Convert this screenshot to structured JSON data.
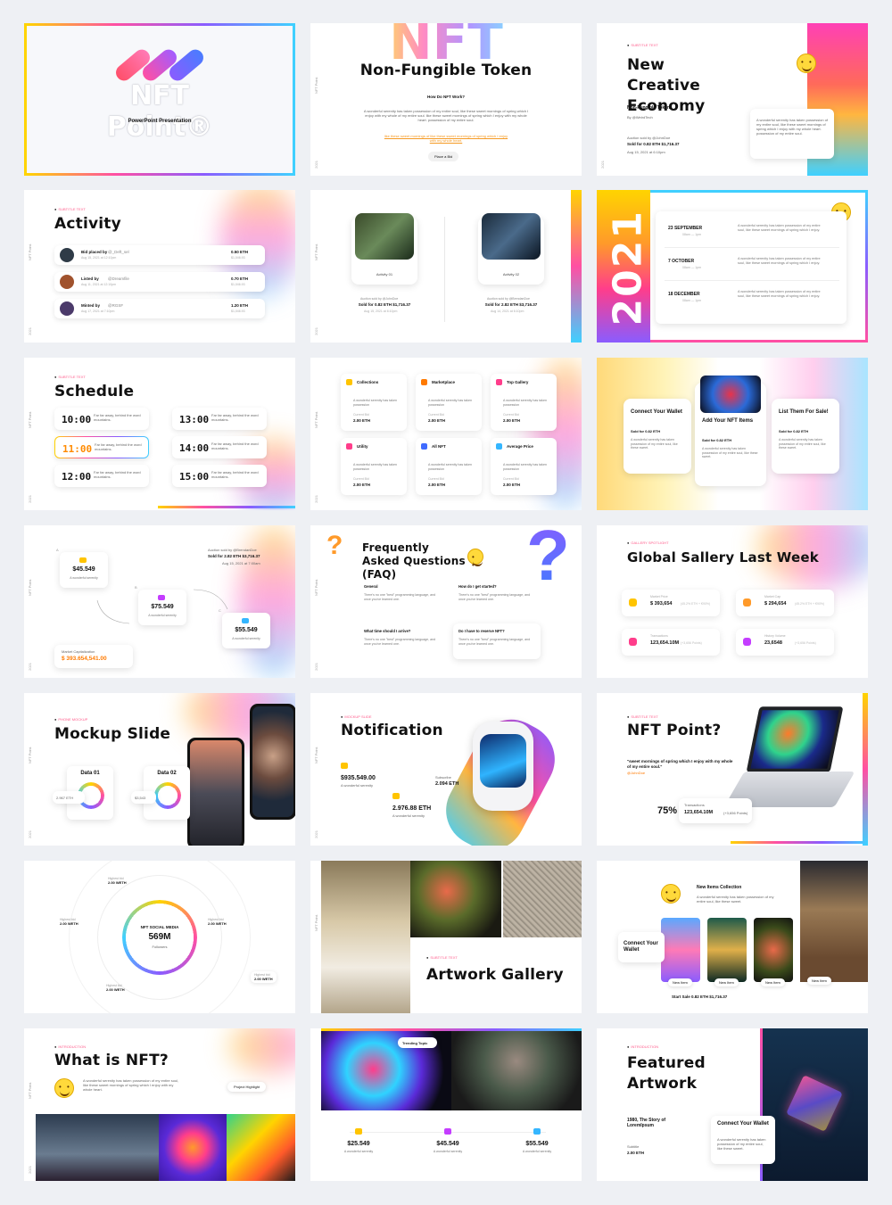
{
  "common": {
    "vertical_label": "NFT Point.",
    "year": "2021"
  },
  "s1": {
    "title": "NFT Point®",
    "subtitle": "PowerPoint Presentation"
  },
  "s2": {
    "bg_text": "NFT",
    "title": "Non-Fungible Token",
    "question": "How Do NFT Work?",
    "body": "A wonderful serenity has taken possession of my entire soul, like these sweet mornings of spring which I enjoy with my whole of my entire soul. like these sweet mornings of spring which I enjoy with my whole heart. possession of my entire soul.",
    "highlight": "like these sweet mornings of like these sweet mornings of spring which I enjoy with my whole heart.",
    "button": "Place a Bid"
  },
  "s3": {
    "tag": "SUBTITLE TEXT",
    "title": "New Creative Economy",
    "sub": "Non-Fungible Token",
    "by": "By @WeirdTech",
    "auction": "Auction sold by @JohnDoe",
    "sold": "Sold for 0.82 ETH $1,716.37",
    "date": "Aug 15, 2021 at 6:10pm",
    "card_text": "A wonderful serenity has taken possession of my entire soul, like these sweet mornings of spring which I enjoy with my whole heart. possession of my entire soul."
  },
  "s4": {
    "tag": "SUBTITLE TEXT",
    "title": "Activity",
    "rows": [
      {
        "label": "Bid placed by",
        "user": "@_Deft_sel",
        "date": "Aug 15, 2021 at 12:10pm",
        "eth": "0.50 ETH",
        "usd": "$1,046.93"
      },
      {
        "label": "Listed by",
        "user": "@Dreamfile",
        "date": "Aug 11, 2021 at 12:10pm",
        "eth": "0.70 ETH",
        "usd": "$1,046.93"
      },
      {
        "label": "Minted by",
        "user": "@RGSF",
        "date": "Aug 17, 2021 at 7:10pm",
        "eth": "1.20 ETH",
        "usd": "$1,046.93"
      }
    ]
  },
  "s5": {
    "cards": [
      {
        "label": "Activity 01",
        "auction": "Auction sold by @JohnDoe",
        "sold": "Sold for 0.82 ETH $1,716.37",
        "date": "Aug 15, 2021 at 6:10pm"
      },
      {
        "label": "Activity 02",
        "auction": "Auction sold by @BrendanDoe",
        "sold": "Sold for 2.82 ETH $3,716.37",
        "date": "Aug 14, 2021 at 6:10pm"
      }
    ]
  },
  "s6": {
    "year": "2021",
    "events": [
      {
        "date": "23 SEPTEMBER",
        "time": "08am — 1pm",
        "text": "A wonderful serenity has taken possession of my entire soul, like these sweet mornings of spring which I enjoy."
      },
      {
        "date": "7 OCTOBER",
        "time": "08am — 1pm",
        "text": "A wonderful serenity has taken possession of my entire soul, like these sweet mornings of spring which I enjoy."
      },
      {
        "date": "18 DECEMBER",
        "time": "08am — 1pm",
        "text": "A wonderful serenity has taken possession of my entire soul, like these sweet mornings of spring which I enjoy."
      }
    ]
  },
  "s7": {
    "tag": "SUBTITLE TEXT",
    "title": "Schedule",
    "desc": "Far far away, behind the word mountains.",
    "times": [
      "10:00",
      "11:00",
      "12:00",
      "13:00",
      "14:00",
      "15:00"
    ]
  },
  "s8": {
    "cards": [
      {
        "title": "Collections",
        "text": "A wonderful serenity has taken possession",
        "label": "Current Bid",
        "value": "2.00 ETH"
      },
      {
        "title": "Marketplace",
        "text": "A wonderful serenity has taken possession",
        "label": "Current Bid",
        "value": "2.00 ETH"
      },
      {
        "title": "Top Gallery",
        "text": "A wonderful serenity has taken possession",
        "label": "Current Bid",
        "value": "2.00 ETH"
      },
      {
        "title": "Utility",
        "text": "A wonderful serenity has taken possession",
        "label": "Current Bid",
        "value": "2.00 ETH"
      },
      {
        "title": "All NFT",
        "text": "A wonderful serenity has taken possession",
        "label": "Current Bid",
        "value": "2.00 ETH"
      },
      {
        "title": "Average Price",
        "text": "A wonderful serenity has taken possession",
        "label": "Current Bid",
        "value": "2.00 ETH"
      }
    ]
  },
  "s9": {
    "cards": [
      {
        "title": "Connect Your Wallet",
        "sold": "Sold for 0.82 ETH",
        "text": "A wonderful serenity has taken possession of my entire soul, like these sweet."
      },
      {
        "title": "Add Your NFT Items",
        "sold": "Sold for 0.82 ETH",
        "text": "A wonderful serenity has taken possession of my entire soul, like these sweet."
      },
      {
        "title": "List Them For Sale!",
        "sold": "Sold for 0.82 ETH",
        "text": "A wonderful serenity has taken possession of my entire soul, like these sweet."
      }
    ]
  },
  "s10": {
    "auction": "Auction sold by @BrendanDoe",
    "sold": "Sold for 2.82 ETH $3,716.37",
    "date": "Aug 15, 2021 at 7:00am",
    "nodes": [
      {
        "letter": "A",
        "value": "$45.549",
        "text": "A wonderful serenity"
      },
      {
        "letter": "B",
        "value": "$75.549",
        "text": "A wonderful serenity"
      },
      {
        "letter": "C",
        "value": "$55.549",
        "text": "A wonderful serenity"
      }
    ],
    "market_label": "Market Capitalization",
    "market_value": "$ 393.654,541.00"
  },
  "s11": {
    "title": "Frequently Asked Questions (FAQ)",
    "items": [
      {
        "q": "General",
        "a": "There's no one \"best\" programming language, and once you've learned one."
      },
      {
        "q": "How do I get started?",
        "a": "There's no one \"best\" programming language, and once you've learned one."
      },
      {
        "q": "What time should I arrive?",
        "a": "There's no one \"best\" programming language, and once you've learned one."
      },
      {
        "q": "Do I have to reserve NFT?",
        "a": "There's no one \"best\" programming language, and once you've learned one."
      }
    ]
  },
  "s12": {
    "tag": "GALLERY SPOTLIGHT",
    "title": "Global Sallery Last Week",
    "stats": [
      {
        "label": "Market Price",
        "value": "$ 393,654",
        "extra": "(45.2% ETH + €90%)"
      },
      {
        "label": "Market Cap",
        "value": "$ 294,654",
        "extra": "(45.2% ETH + €90%)"
      },
      {
        "label": "Transactions",
        "value": "123,654.10M",
        "extra": "(+3,656 Points)"
      },
      {
        "label": "History Volume",
        "value": "23,6548",
        "extra": "(+3,656 Points)"
      }
    ]
  },
  "s13": {
    "tag": "PHONE MOCKUP",
    "title": "Mockup Slide",
    "d1": "Data 01",
    "v1": "2.967 ETH",
    "d2": "Data 02",
    "v2": "$3,543"
  },
  "s14": {
    "tag": "MOCKUP SLIDE",
    "title": "Notification",
    "v1": "$935.549.00",
    "t1": "A wonderful serenity",
    "v2": "2.976.88 ETH",
    "t2": "A wonderful serenity",
    "l3": "Subscribe",
    "v3": "2.094 ETH"
  },
  "s15": {
    "tag": "SUBTITLE TEXT",
    "title": "NFT Point?",
    "quote": "\"sweet mornings of spring which I enjoy with my whole of my entire soul.\"",
    "author": "@JohnDoe",
    "pct": "75%",
    "label": "Transactions",
    "value": "123,654.10M",
    "extra": "(+3,656 Points)"
  },
  "s16": {
    "center_title": "NFT SOCIAL MEDIA",
    "center_value": "569M",
    "center_sub": "Followers",
    "bids": [
      {
        "label": "Highest bid",
        "value": "2.00 WETH"
      },
      {
        "label": "Highest bid",
        "value": "2.00 WETH"
      },
      {
        "label": "Highest bid",
        "value": "2.00 WETH"
      },
      {
        "label": "Highest bid",
        "value": "2.00 WETH"
      },
      {
        "label": "Highest bid",
        "value": "2.00 WETH"
      }
    ]
  },
  "s17": {
    "tag": "SUBTITLE TEXT",
    "title": "Artwork Gallery"
  },
  "s18": {
    "heading": "New Items Collection",
    "text": "A wonderful serenity has taken possession of my entire soul, like these sweet.",
    "connect": "Connect Your Wallet",
    "item": "New Item",
    "footer": "Start Sale 0.82 ETH $1,716.37"
  },
  "s19": {
    "tag": "INTRODUCTION",
    "title": "What is NFT?",
    "text": "A wonderful serenity has taken possession of my entire soul, like these sweet mornings of spring which I enjoy with my whole heart.",
    "button": "Project Highlight"
  },
  "s20": {
    "tag": "Trending Topic",
    "stats": [
      {
        "value": "$25.549",
        "text": "A wonderful serenity"
      },
      {
        "value": "$45.549",
        "text": "A wonderful serenity"
      },
      {
        "value": "$55.549",
        "text": "A wonderful serenity"
      }
    ]
  },
  "s21": {
    "tag": "INTRODUCTION",
    "title": "Featured Artwork",
    "story": "1980, The Story of LoremIpsum",
    "label": "Subtitle",
    "value": "2.00 ETH",
    "connect": "Connect Your Wallet",
    "text": "A wonderful serenity has taken possession of my entire soul, like these sweet."
  }
}
